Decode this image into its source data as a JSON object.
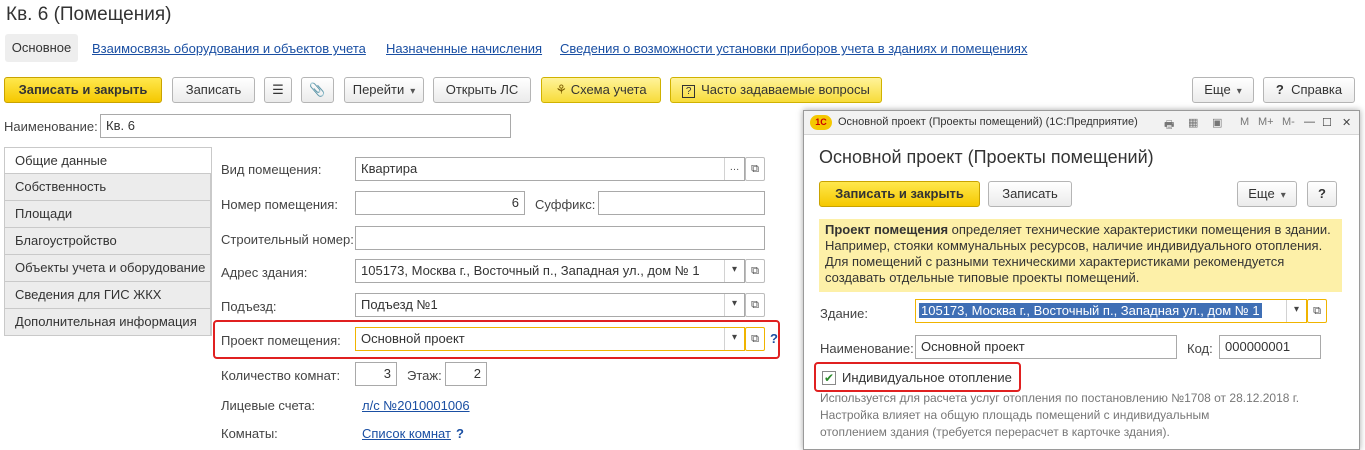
{
  "window": {
    "title": "Кв. 6 (Помещения)"
  },
  "tabs": {
    "active": "Основное",
    "links": [
      "Взаимосвязь оборудования и объектов учета",
      "Назначенные начисления",
      "Сведения о возможности установки приборов учета в зданиях и помещениях"
    ]
  },
  "toolbar": {
    "save_close": "Записать и закрыть",
    "save": "Записать",
    "goto": "Перейти",
    "open_ls": "Открыть ЛС",
    "scheme": "Схема учета",
    "faq": "Часто задаваемые вопросы",
    "more": "Еще",
    "help": "Справка"
  },
  "name_field": {
    "label": "Наименование:",
    "value": "Кв. 6"
  },
  "side_tabs": [
    "Общие данные",
    "Собственность",
    "Площади",
    "Благоустройство",
    "Объекты учета и оборудование",
    "Сведения для ГИС ЖКХ",
    "Дополнительная информация"
  ],
  "form": {
    "room_type": {
      "label": "Вид помещения:",
      "value": "Квартира"
    },
    "room_number": {
      "label": "Номер помещения:",
      "value": "6"
    },
    "suffix": {
      "label": "Суффикс:",
      "value": ""
    },
    "build_number": {
      "label": "Строительный номер:",
      "value": ""
    },
    "address": {
      "label": "Адрес здания:",
      "value": "105173, Москва г., Восточный п., Западная ул., дом № 1"
    },
    "entrance": {
      "label": "Подъезд:",
      "value": "Подъезд №1"
    },
    "project": {
      "label": "Проект помещения:",
      "value": "Основной проект",
      "help": "?"
    },
    "rooms_count": {
      "label": "Количество комнат:",
      "value": "3"
    },
    "floor": {
      "label": "Этаж:",
      "value": "2"
    },
    "accounts": {
      "label": "Лицевые счета:",
      "link": "л/с №2010001006"
    },
    "rooms": {
      "label": "Комнаты:",
      "link": "Список комнат",
      "help": "?"
    }
  },
  "modal": {
    "bar_title": "Основной проект (Проекты помещений)  (1С:Предприятие)",
    "logo": "1С",
    "bar_icons": [
      "M",
      "M+",
      "M-"
    ],
    "heading": "Основной проект (Проекты помещений)",
    "save_close": "Записать и закрыть",
    "save": "Записать",
    "more": "Еще",
    "help": "?",
    "info_bold": "Проект помещения",
    "info_rest": " определяет технические характеристики помещения в здании. Например, стояки коммунальных ресурсов, наличие индивидуального отопления. Для помещений с разными техническими характеристиками рекомендуется создавать отдельные типовые проекты помещений.",
    "building": {
      "label": "Здание:",
      "value": "105173, Москва г., Восточный п., Западная ул., дом № 1"
    },
    "name": {
      "label": "Наименование:",
      "value": "Основной проект"
    },
    "code": {
      "label": "Код:",
      "value": "000000001"
    },
    "heating": {
      "label": "Индивидуальное отопление",
      "checked": true
    },
    "note_lines": [
      "Используется для расчета услуг отопления по постановлению №1708 от 28.12.2018 г.",
      "Настройка влияет на общую площадь помещений с индивидуальным",
      "отоплением здания (требуется перерасчет в карточке здания)."
    ]
  },
  "colors": {
    "accent_yellow": "#f5c800",
    "link_blue": "#1a4fa3",
    "highlight_red": "#e02020"
  }
}
